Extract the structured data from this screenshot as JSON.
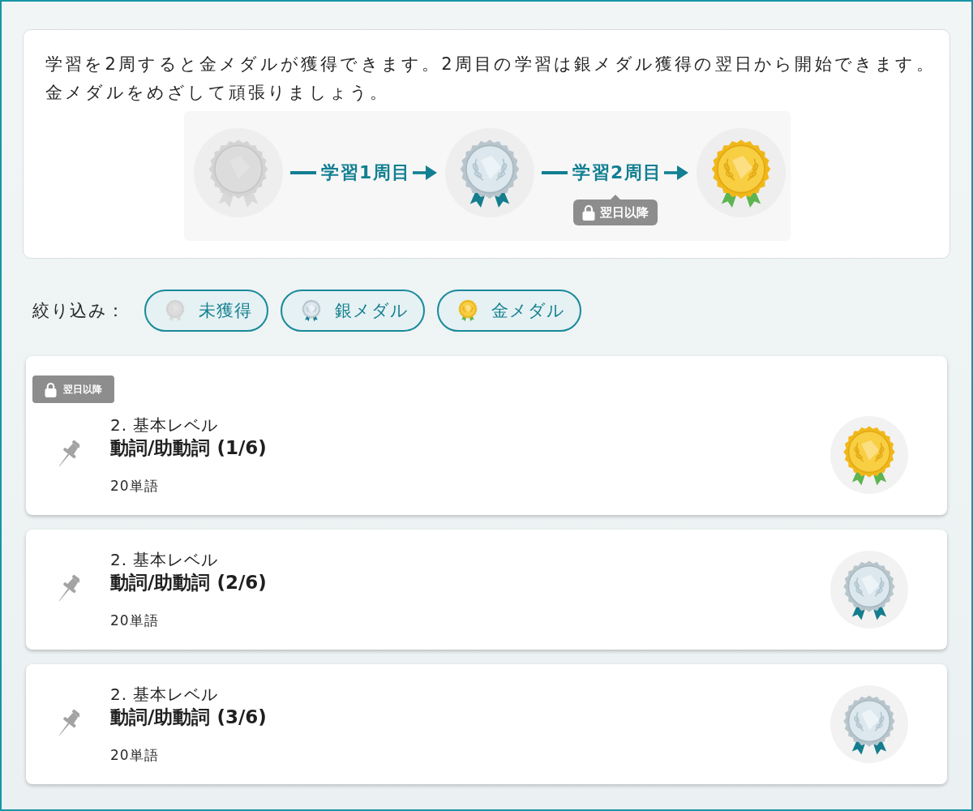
{
  "intro": {
    "lines": [
      "学習を2周すると金メダルが獲得できます。2周目の学習は銀メダル獲得の翌日から開始できます。",
      "金メダルをめざして頑張りましょう。"
    ]
  },
  "diagram": {
    "stages": [
      {
        "kind": "none"
      },
      {
        "kind": "silver"
      },
      {
        "kind": "gold"
      }
    ],
    "arrows": [
      {
        "label": "学習1周目"
      },
      {
        "label": "学習2周目",
        "lock": "翌日以降"
      }
    ]
  },
  "filter": {
    "label": "絞り込み：",
    "chips": [
      {
        "label": "未獲得",
        "kind": "none"
      },
      {
        "label": "銀メダル",
        "kind": "silver"
      },
      {
        "label": "金メダル",
        "kind": "gold"
      }
    ]
  },
  "units": [
    {
      "lock": "翌日以降",
      "level": "2. 基本レベル",
      "title": "動詞/助動詞 (1/6)",
      "count": "20単語",
      "medal": {
        "kind": "gold"
      }
    },
    {
      "level": "2. 基本レベル",
      "title": "動詞/助動詞 (2/6)",
      "count": "20単語",
      "medal": {
        "kind": "silver"
      }
    },
    {
      "level": "2. 基本レベル",
      "title": "動詞/助動詞 (3/6)",
      "count": "20単語",
      "medal": {
        "kind": "silver"
      }
    }
  ]
}
